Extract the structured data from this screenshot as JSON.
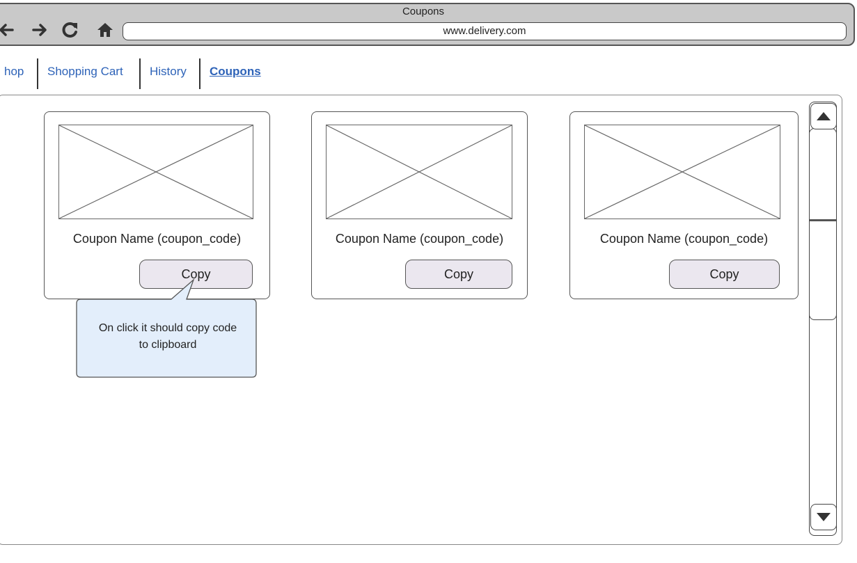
{
  "window": {
    "title": "Coupons",
    "url": "www.delivery.com"
  },
  "nav": {
    "back_icon": "back-arrow-icon",
    "forward_icon": "forward-arrow-icon",
    "reload_icon": "reload-icon",
    "home_icon": "home-icon"
  },
  "tabs": [
    {
      "label": "hop",
      "active": false
    },
    {
      "label": "Shopping Cart",
      "active": false
    },
    {
      "label": "History",
      "active": false
    },
    {
      "label": "Coupons",
      "active": true
    }
  ],
  "coupons": [
    {
      "name": "Coupon Name (coupon_code)",
      "button_label": "Copy"
    },
    {
      "name": "Coupon Name (coupon_code)",
      "button_label": "Copy"
    },
    {
      "name": "Coupon Name (coupon_code)",
      "button_label": "Copy"
    }
  ],
  "callout": {
    "text_line1": "On click it should copy code",
    "text_line2": "to clipboard"
  },
  "colors": {
    "link": "#2e63b8",
    "button_bg": "#ebe7ef",
    "callout_bg": "#e3eefb",
    "chrome_bg": "#c9c9c9"
  }
}
